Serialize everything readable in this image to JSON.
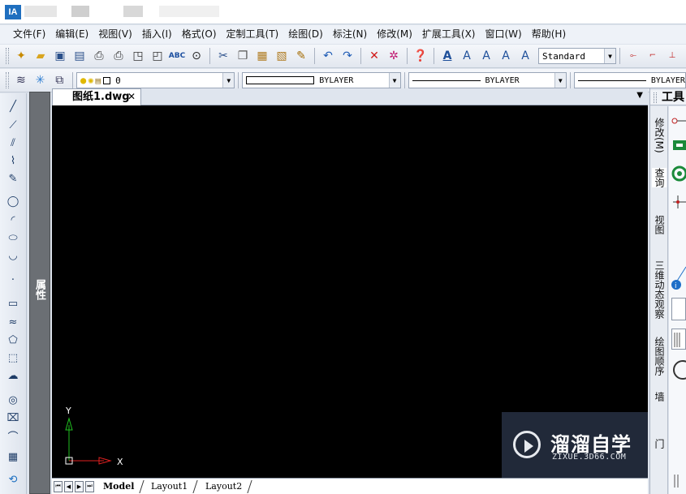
{
  "menus": [
    "文件(F)",
    "编辑(E)",
    "视图(V)",
    "插入(I)",
    "格式(O)",
    "定制工具(T)",
    "绘图(D)",
    "标注(N)",
    "修改(M)",
    "扩展工具(X)",
    "窗口(W)",
    "帮助(H)"
  ],
  "title_bar": {
    "app_icon_text": "IA"
  },
  "toolbar_standard": {
    "icons": [
      "new-file-icon",
      "open-file-icon",
      "save-icon",
      "save-as-icon",
      "print-icon",
      "plot-icon",
      "print-preview-icon",
      "publish-icon",
      "spell-check-icon",
      "find-icon",
      "cut-icon",
      "copy-icon",
      "paste-icon",
      "paste-special-icon",
      "match-properties-icon",
      "undo-icon",
      "redo-icon",
      "delete-icon",
      "purge-icon",
      "help-icon",
      "text-style-icon",
      "single-text-icon",
      "multiline-text-icon",
      "edit-text-icon",
      "find-text-icon"
    ],
    "text_style_value": "Standard"
  },
  "toolbar_layers": {
    "layer_value": "0",
    "color_value": "BYLAYER",
    "linetype_value": "BYLAYER",
    "lineweight_value": "BYLAYER"
  },
  "properties_panel": {
    "label": "属性"
  },
  "document_tab": {
    "name": "图纸1.dwg",
    "close": "✕"
  },
  "ucs": {
    "x_label": "X",
    "y_label": "Y"
  },
  "layout_tabs": [
    "Model",
    "Layout1",
    "Layout2"
  ],
  "tool_palette": {
    "title": "工具",
    "tabs": [
      "修改(M)",
      "查询",
      "视图",
      "三维动态观察",
      "绘图顺序",
      "墙",
      "门"
    ]
  },
  "watermark": {
    "name": "溜溜自学",
    "url": "ZIXUE.3D66.COM"
  }
}
